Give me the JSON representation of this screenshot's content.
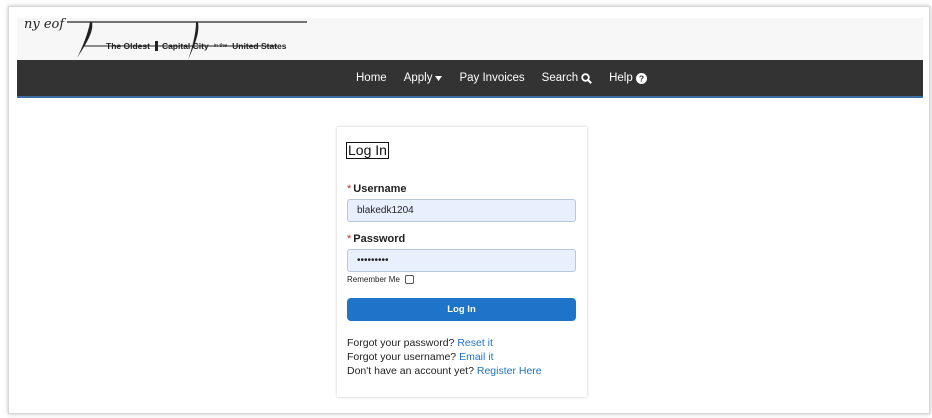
{
  "logo": {
    "script_text": "ny eof",
    "tagline": [
      "The Oldest",
      "Capital City",
      "in the",
      "United States"
    ]
  },
  "nav": {
    "items": [
      {
        "label": "Home",
        "icon": ""
      },
      {
        "label": "Apply",
        "icon": "caret-down-icon"
      },
      {
        "label": "Pay Invoices",
        "icon": ""
      },
      {
        "label": "Search",
        "icon": "search-icon"
      },
      {
        "label": "Help",
        "icon": "question-circle-icon"
      }
    ]
  },
  "login": {
    "title": "Log In",
    "username_label": "Username",
    "username_value": "blakedk1204",
    "password_label": "Password",
    "password_value": "•••••••••",
    "required_marker": "*",
    "remember_label": "Remember Me",
    "remember_checked": false,
    "submit_label": "Log In",
    "forgot_password_text": "Forgot your password?",
    "forgot_password_link": "Reset it",
    "forgot_username_text": "Forgot your username?",
    "forgot_username_link": "Email it",
    "register_text": "Don't have an account yet?",
    "register_link": "Register Here"
  },
  "colors": {
    "navbar": "#333333",
    "accent": "#1d74c8",
    "input_bg": "#e8f0fe",
    "required": "#c62828"
  }
}
